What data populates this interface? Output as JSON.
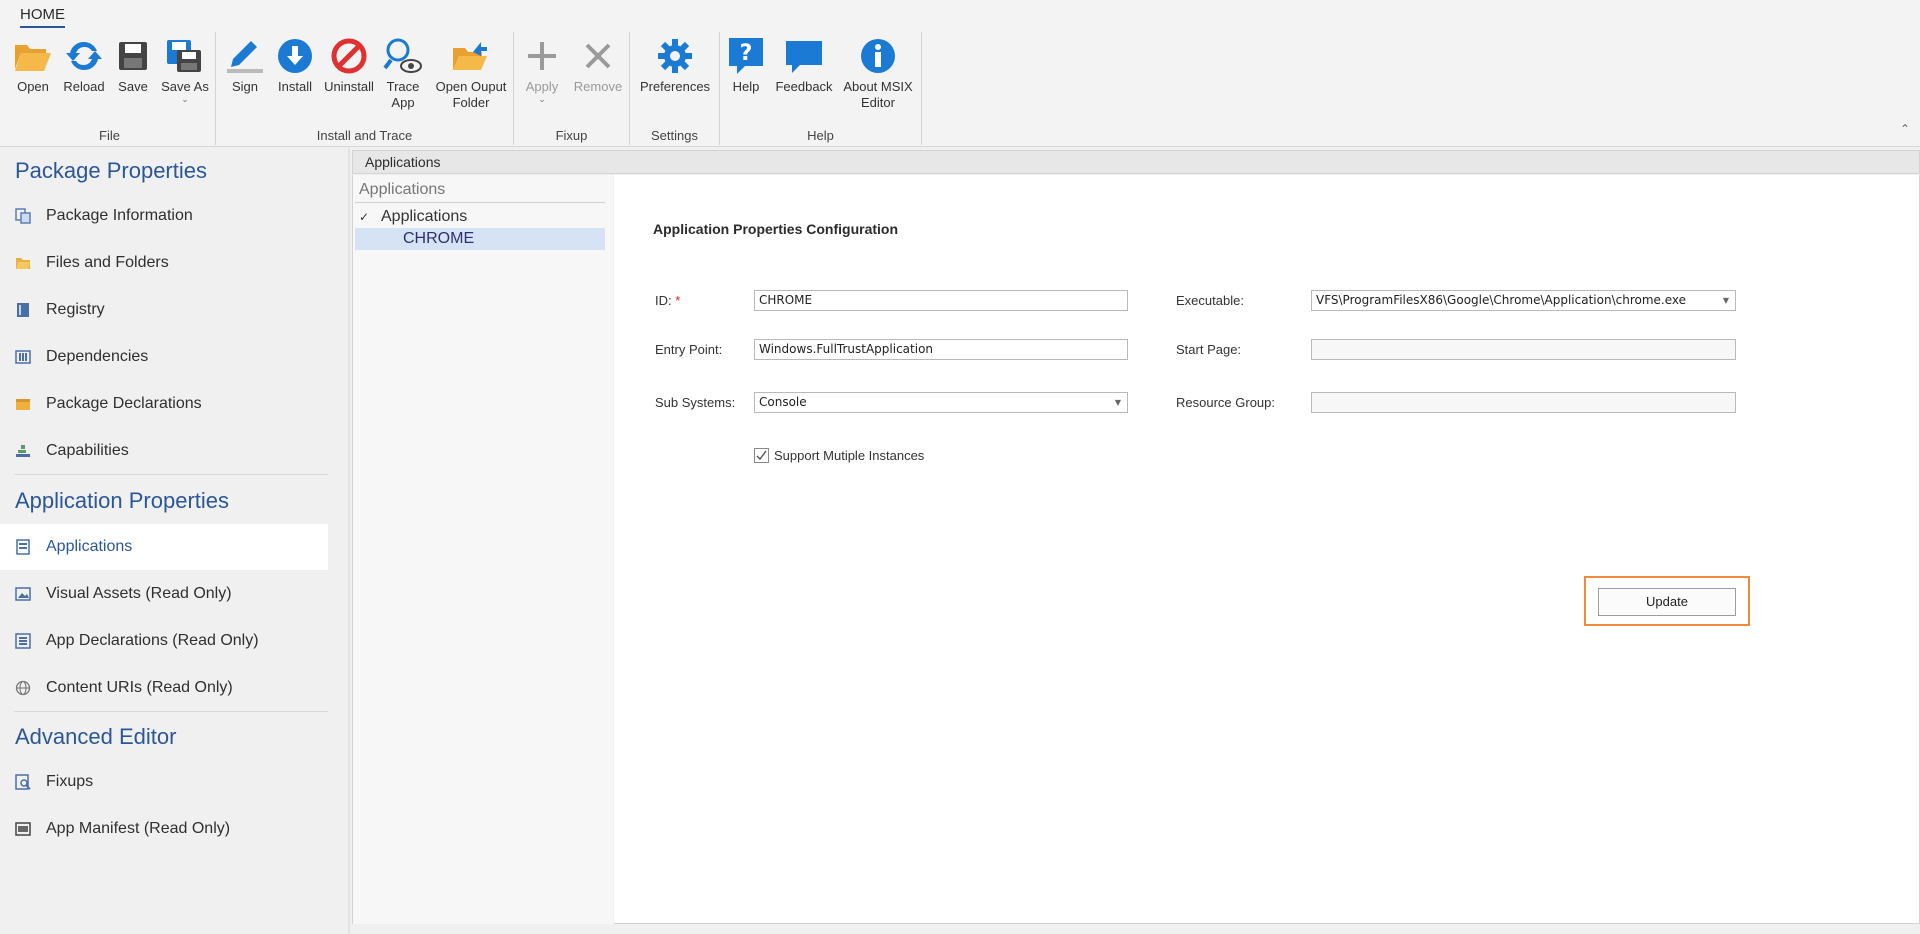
{
  "ribbon": {
    "tab": "HOME",
    "groups": {
      "file": {
        "label": "File",
        "open": "Open",
        "reload": "Reload",
        "save": "Save",
        "save_as": "Save As"
      },
      "install": {
        "label": "Install and Trace",
        "sign": "Sign",
        "install": "Install",
        "uninstall": "Uninstall",
        "trace_l1": "Trace",
        "trace_l2": "App",
        "openout_l1": "Open Ouput",
        "openout_l2": "Folder"
      },
      "fixup": {
        "label": "Fixup",
        "apply": "Apply",
        "remove": "Remove"
      },
      "settings": {
        "label": "Settings",
        "preferences": "Preferences"
      },
      "help": {
        "label": "Help",
        "help": "Help",
        "feedback": "Feedback",
        "about_l1": "About MSIX",
        "about_l2": "Editor"
      }
    },
    "colors": {
      "blue": "#1a7ad4",
      "red": "#e03030",
      "orange": "#f0a030",
      "gray": "#9a9a9a"
    }
  },
  "sidebar": {
    "section_package": "Package Properties",
    "package_items": [
      {
        "label": "Package Information",
        "icon": "package-info-icon"
      },
      {
        "label": "Files and Folders",
        "icon": "folder-icon"
      },
      {
        "label": "Registry",
        "icon": "registry-icon"
      },
      {
        "label": "Dependencies",
        "icon": "dependencies-icon"
      },
      {
        "label": "Package Declarations",
        "icon": "declarations-icon"
      },
      {
        "label": "Capabilities",
        "icon": "capabilities-icon"
      }
    ],
    "section_application": "Application Properties",
    "application_items": [
      {
        "label": "Applications",
        "icon": "applications-icon"
      },
      {
        "label": "Visual Assets (Read Only)",
        "icon": "visual-assets-icon"
      },
      {
        "label": "App Declarations (Read Only)",
        "icon": "app-declarations-icon"
      },
      {
        "label": "Content URIs (Read Only)",
        "icon": "globe-icon"
      }
    ],
    "section_advanced": "Advanced Editor",
    "advanced_items": [
      {
        "label": "Fixups",
        "icon": "fixups-icon"
      },
      {
        "label": "App Manifest (Read Only)",
        "icon": "manifest-icon"
      }
    ]
  },
  "main": {
    "header": "Applications",
    "tree": {
      "title": "Applications",
      "root": "Applications",
      "child": "CHROME"
    },
    "form": {
      "title": "Application Properties Configuration",
      "id_label": "ID:",
      "id_required": "*",
      "id_value": "CHROME",
      "entry_label": "Entry Point:",
      "entry_value": "Windows.FullTrustApplication",
      "subsys_label": "Sub Systems:",
      "subsys_value": "Console",
      "exec_label": "Executable:",
      "exec_value": "VFS\\ProgramFilesX86\\Google\\Chrome\\Application\\chrome.exe",
      "start_label": "Start Page:",
      "start_value": "",
      "resource_label": "Resource Group:",
      "resource_value": "",
      "multi_label": "Support Mutiple Instances",
      "multi_checked": true,
      "update_label": "Update"
    }
  }
}
